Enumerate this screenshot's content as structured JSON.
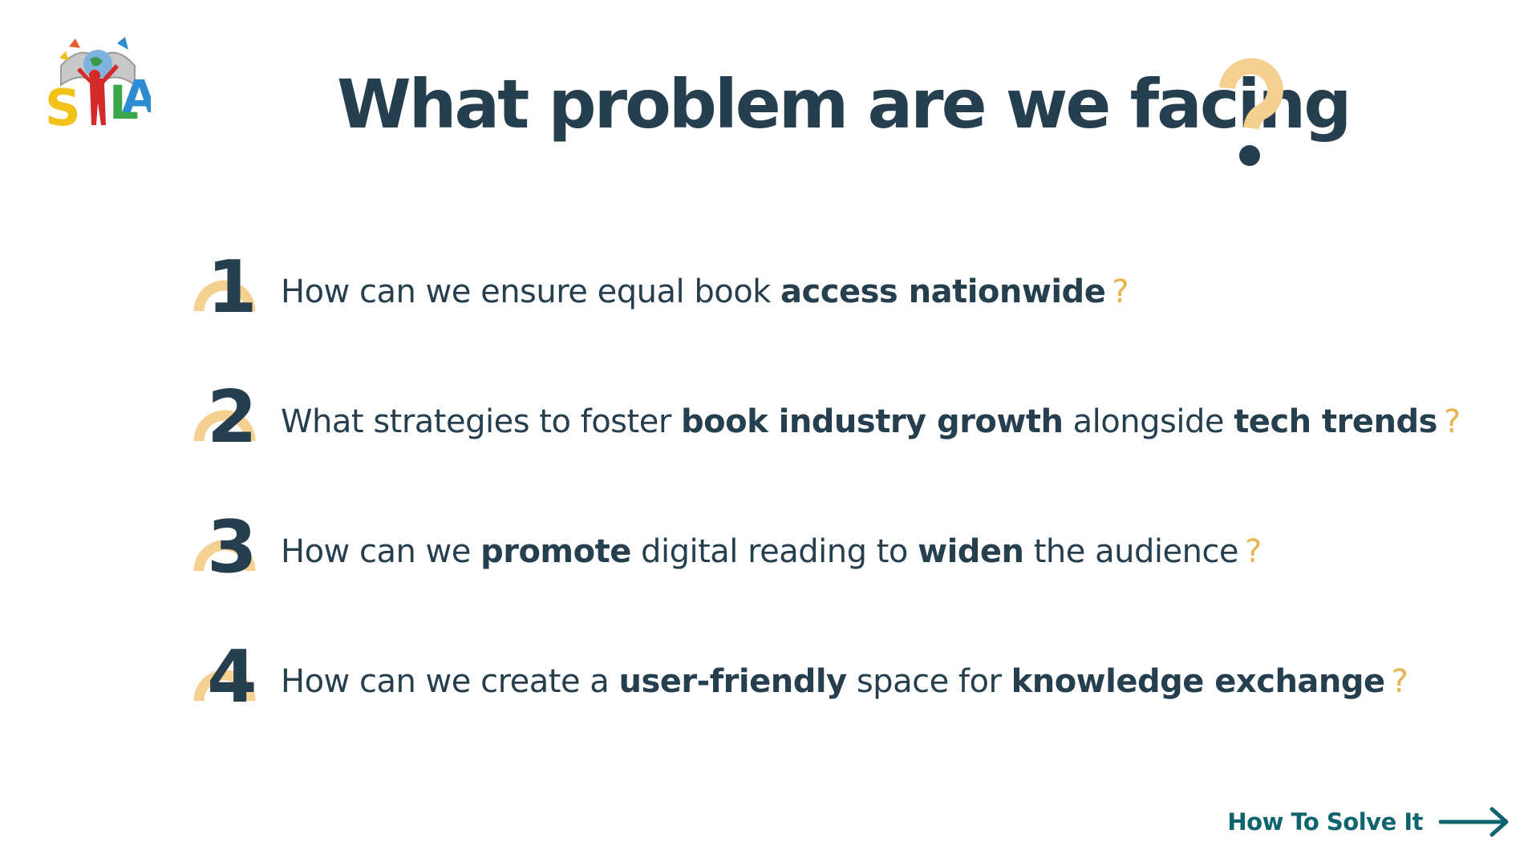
{
  "logo": {
    "text": "SILA",
    "icon": "sila-logo-icon"
  },
  "title": {
    "text": "What problem are we facing",
    "decor_icon": "question-mark-icon"
  },
  "questions": [
    {
      "number": "1",
      "parts": [
        {
          "text": "How can we ensure equal book ",
          "bold": false
        },
        {
          "text": "access nationwide",
          "bold": true
        }
      ],
      "mark": "?"
    },
    {
      "number": "2",
      "parts": [
        {
          "text": "What strategies to foster ",
          "bold": false
        },
        {
          "text": "book industry growth",
          "bold": true
        },
        {
          "text": " alongside ",
          "bold": false
        },
        {
          "text": "tech trends",
          "bold": true
        }
      ],
      "mark": "?"
    },
    {
      "number": "3",
      "parts": [
        {
          "text": "How can we ",
          "bold": false
        },
        {
          "text": "promote",
          "bold": true
        },
        {
          "text": " digital reading to ",
          "bold": false
        },
        {
          "text": "widen",
          "bold": true
        },
        {
          "text": " the audience",
          "bold": false
        }
      ],
      "mark": "?"
    },
    {
      "number": "4",
      "parts": [
        {
          "text": "How can we create a ",
          "bold": false
        },
        {
          "text": "user-friendly",
          "bold": true
        },
        {
          "text": " space for ",
          "bold": false
        },
        {
          "text": "knowledge exchange",
          "bold": true
        }
      ],
      "mark": "?"
    }
  ],
  "next": {
    "label": "How To Solve It",
    "icon": "arrow-right-icon"
  },
  "colors": {
    "text_dark": "#263f4f",
    "accent_yellow": "#e8b44e",
    "accent_light": "#f5d090",
    "link_teal": "#0f6470"
  }
}
